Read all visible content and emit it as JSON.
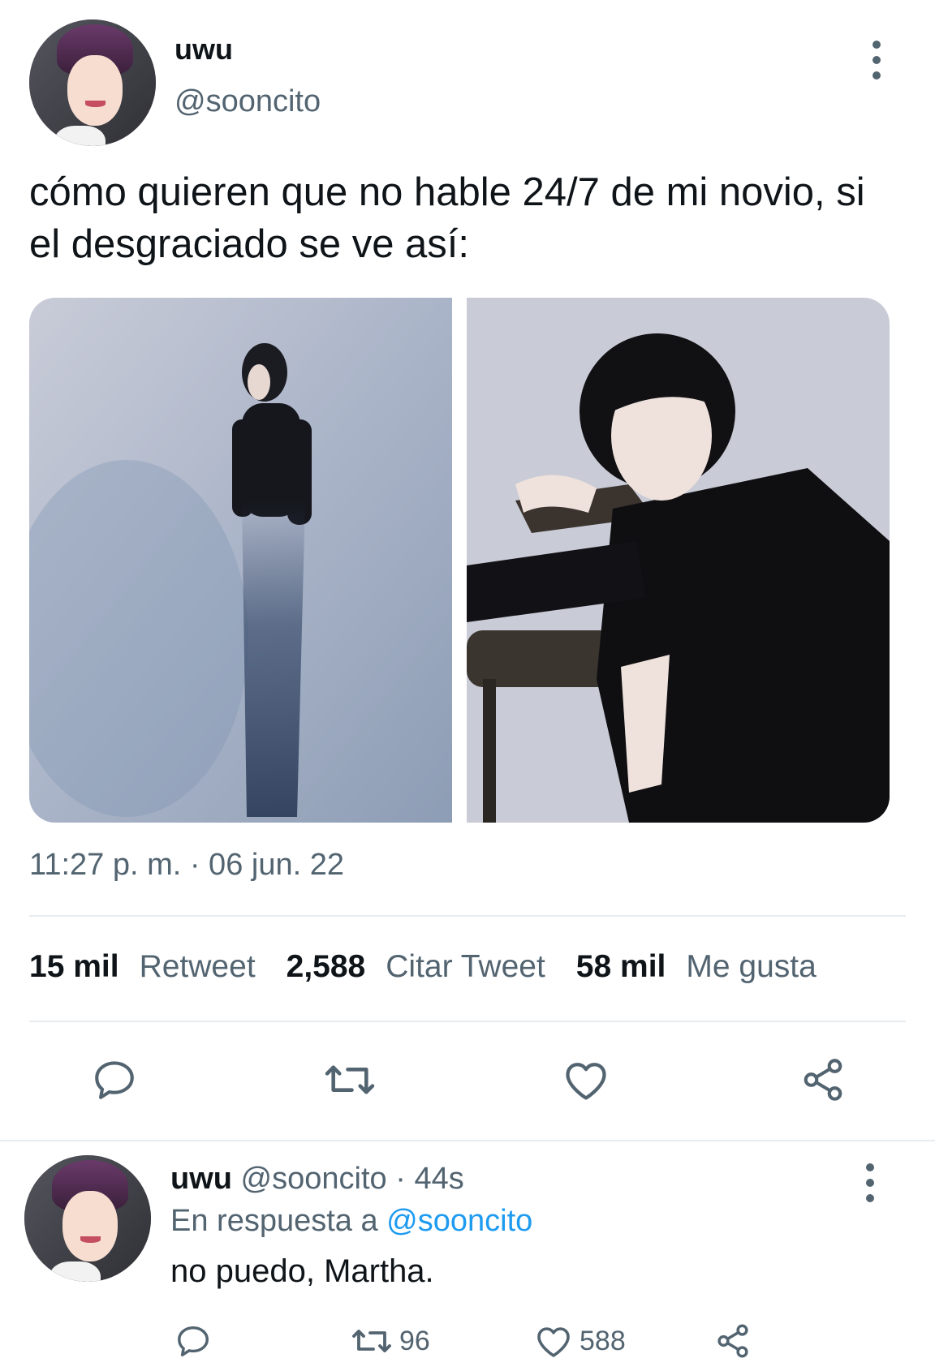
{
  "tweet": {
    "display_name": "uwu",
    "handle": "@sooncito",
    "text": "cómo quieren que no hable 24/7 de mi novio, si el desgraciado se ve así:",
    "timestamp": "11:27 p. m. · 06 jun. 22",
    "stats": {
      "retweets_count": "15 mil",
      "retweets_label": "Retweet",
      "quotes_count": "2,588",
      "quotes_label": "Citar Tweet",
      "likes_count": "58 mil",
      "likes_label": "Me gusta"
    },
    "actions": [
      "reply-icon",
      "retweet-icon",
      "heart-icon",
      "share-icon"
    ]
  },
  "reply": {
    "display_name": "uwu",
    "handle": "@sooncito",
    "age": "· 44s",
    "in_reply_prefix": "En respuesta a",
    "in_reply_handle": "@sooncito",
    "text": "no puedo, Martha.",
    "retweets": "96",
    "likes": "588"
  },
  "colors": {
    "text_primary": "#0f1419",
    "text_secondary": "#536471",
    "link": "#1d9bf0",
    "divider": "#e6ecf0"
  }
}
